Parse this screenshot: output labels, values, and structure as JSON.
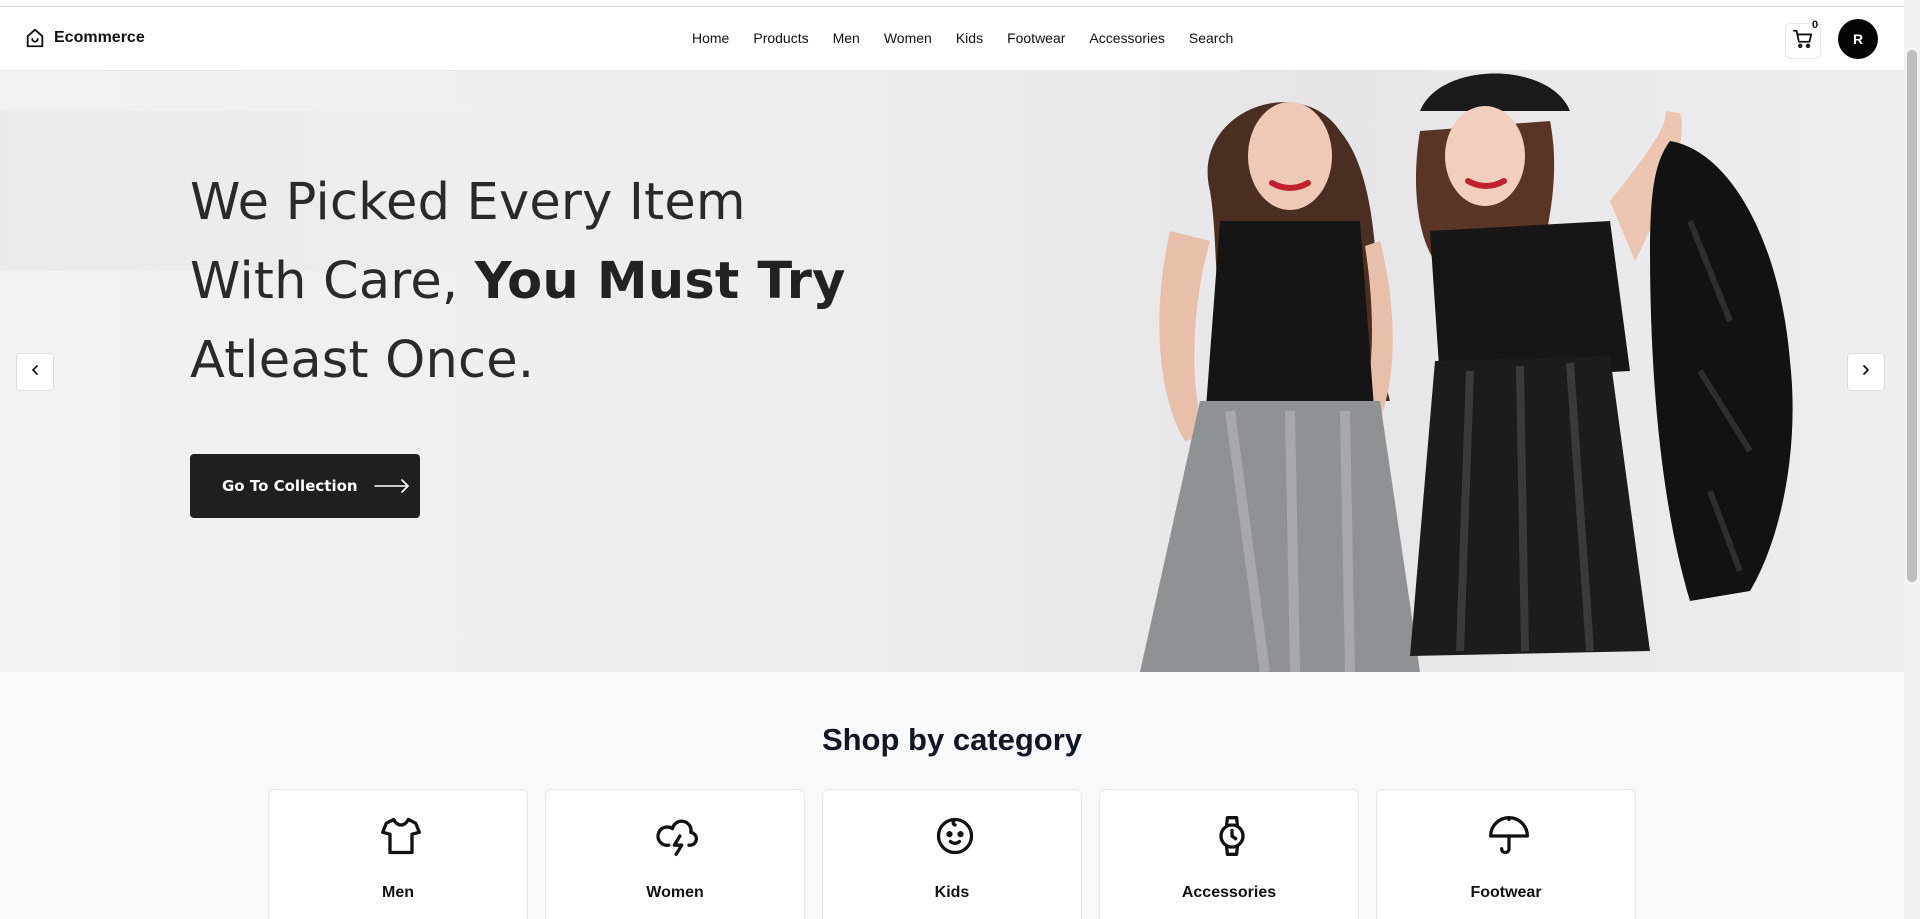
{
  "brand": {
    "name": "Ecommerce",
    "icon": "store-icon"
  },
  "nav": {
    "items": [
      "Home",
      "Products",
      "Men",
      "Women",
      "Kids",
      "Footwear",
      "Accessories",
      "Search"
    ]
  },
  "cart": {
    "count": "0",
    "icon": "cart-icon"
  },
  "user": {
    "avatar_initial": "R"
  },
  "hero": {
    "line1": "We Picked Every Item",
    "line2_regular": "With Care, ",
    "line2_bold": "You Must Try",
    "line3": "Atleast Once.",
    "cta_label": "Go To Collection",
    "prev_icon": "chevron-left-icon",
    "next_icon": "chevron-right-icon"
  },
  "categories": {
    "title": "Shop by category",
    "items": [
      {
        "label": "Men",
        "icon": "tshirt-icon"
      },
      {
        "label": "Women",
        "icon": "cloud-lightning-icon"
      },
      {
        "label": "Kids",
        "icon": "baby-face-icon"
      },
      {
        "label": "Accessories",
        "icon": "watch-icon"
      },
      {
        "label": "Footwear",
        "icon": "umbrella-icon"
      }
    ]
  },
  "colors": {
    "accent_dark": "#1f1f20",
    "page_bg": "#f8f9fb"
  }
}
